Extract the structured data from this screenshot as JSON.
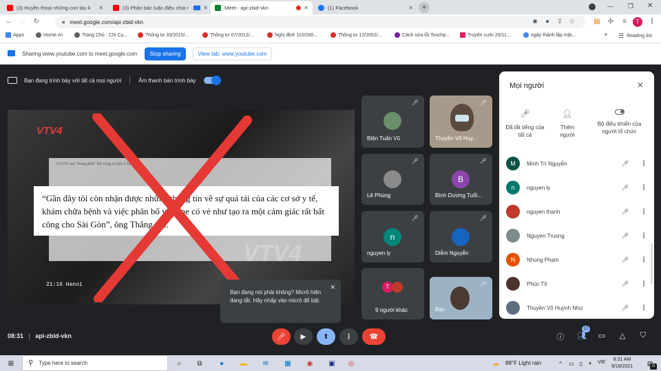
{
  "tabs": [
    {
      "title": "(3) Huyền thoại những con tàu k",
      "fav": "#ff0000"
    },
    {
      "title": "(3) Phản bác luận điệu chia r",
      "fav": "#ff0000"
    },
    {
      "title": "Meet - api-zbid-vkn",
      "fav": "#00832d"
    },
    {
      "title": "(1) Facebook",
      "fav": "#1877f2"
    }
  ],
  "address": "meet.google.com/api-zbid-vkn",
  "bookmarks": [
    "Apps",
    "Home.vn",
    "Trang Chủ - Chi Cụ...",
    "Thông tư 33/2015/...",
    "Thông tư 07/2012/...",
    "Nghị định 110/200...",
    "Thông tư 12/2002/...",
    "Cách sửa lỗi Touchp...",
    "Truyện cười 20/11...",
    "ngày thành lập mặt..."
  ],
  "reading_list": "Reading list",
  "profile_initial": "T",
  "sharing": {
    "text": "Sharing www.youtube.com to meet.google.com",
    "stop": "Stop sharing",
    "view": "View tab: www.youtube.com"
  },
  "presenting": {
    "text": "Bạn đang trình bày với tất cả mọi người",
    "audio": "Âm thanh bản trình bày"
  },
  "video": {
    "logo": "VTV4",
    "blurb": "COVID tạo \"bong phất\" bắt công xã hội ở Sài Gòn",
    "quote": "“Gần đây tôi còn nhận được những thông tin về sự quá tải của các cơ sở y tế, khám chữa bệnh và việc phân bổ vaccine có vẻ như tạo ra một cảm giác rất bất công cho Sài Gòn”, ông Thắng nói.",
    "time": "21:16 Hanoi",
    "wm": "VTV4"
  },
  "participants_tiles": [
    {
      "name": "Biện Tuấn Vũ"
    },
    {
      "name": "Thuyên Võ Huy..."
    },
    {
      "name": "Lê Phùng"
    },
    {
      "name": "Bình Dương Tuổi..."
    },
    {
      "name": "nguyen ly",
      "initial": "n"
    },
    {
      "name": "Diễm Nguyễn"
    },
    {
      "name": "9 người khác"
    },
    {
      "name": "Bạn"
    }
  ],
  "toast": {
    "text": "Bạn đang nói phải không? Micrô hiện đang tắt. Hãy nhấp vào micrô để bật."
  },
  "panel": {
    "title": "Mọi người",
    "actions": [
      {
        "label": "Đã tắt tiếng của tất cả"
      },
      {
        "label": "Thêm người"
      },
      {
        "label": "Bộ điều khiển của người tổ chức"
      }
    ],
    "people": [
      {
        "name": "Minh Trí Nguyễn",
        "initial": "M",
        "color": "#0b5345"
      },
      {
        "name": "nguyen ly",
        "initial": "n",
        "color": "#00796b"
      },
      {
        "name": "nguyen thanh",
        "initial": "",
        "color": "#c0392b"
      },
      {
        "name": "Nguyen Truong",
        "initial": "",
        "color": "#7f8c8d"
      },
      {
        "name": "Nhung Phạm",
        "initial": "N",
        "color": "#e65100"
      },
      {
        "name": "Phúc Tô",
        "initial": "",
        "color": "#4e342e"
      },
      {
        "name": "Thuyên Võ Huỳnh Như",
        "initial": "",
        "color": "#5d6d7e"
      }
    ]
  },
  "meeting": {
    "time": "08:31",
    "code": "api-zbid-vkn",
    "people_count": "17"
  },
  "taskbar": {
    "search": "Type here to search",
    "weather": "88°F  Light rain",
    "lang": "VIE",
    "time": "8:31 AM",
    "date": "9/18/2021",
    "notif": "21"
  }
}
